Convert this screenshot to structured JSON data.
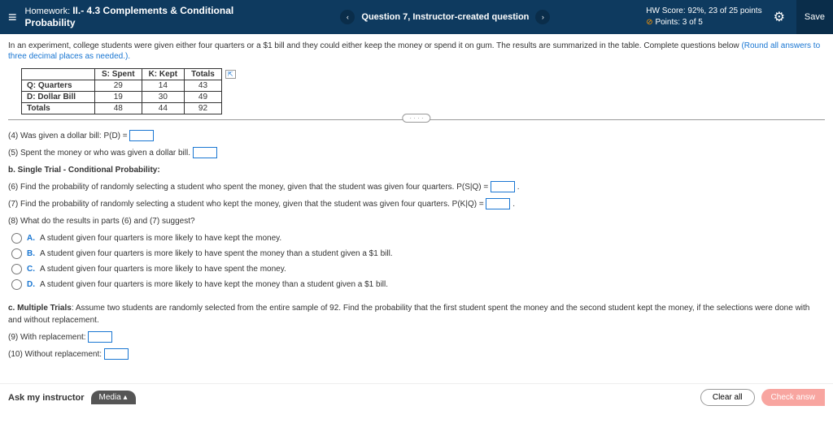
{
  "header": {
    "hw_label": "Homework:",
    "hw_title": "II.- 4.3 Complements & Conditional Probability",
    "question": "Question 7, Instructor-created question",
    "score_line": "HW Score: 92%, 23 of 25 points",
    "points_line": "Points: 3 of 5",
    "save": "Save"
  },
  "intro": {
    "text": "In an experiment, college students were given either four quarters or a $1 bill and they could either keep the money or spend it on gum. The results are summarized in the table. Complete questions below ",
    "note": "(Round all answers to three decimal places as needed.)."
  },
  "table": {
    "h1": "S: Spent",
    "h2": "K: Kept",
    "h3": "Totals",
    "r1": {
      "label": "Q: Quarters",
      "c1": "29",
      "c2": "14",
      "c3": "43"
    },
    "r2": {
      "label": "D: Dollar Bill",
      "c1": "19",
      "c2": "30",
      "c3": "49"
    },
    "r3": {
      "label": "Totals",
      "c1": "48",
      "c2": "44",
      "c3": "92"
    }
  },
  "q4": "(4) Was given a dollar bill: P(D) = ",
  "q5": "(5) Spent the money or who was given a dollar bill. ",
  "bheader": "b. Single Trial - Conditional Probability:",
  "q6": "(6) Find the probability of randomly selecting a student who spent the money, given that the student was given four quarters. P(S|Q) = ",
  "q7": "(7) Find the probability of randomly selecting a student who kept the money, given that the student was given four quarters. P(K|Q) = ",
  "q8": "(8) What do the results in parts (6) and (7) suggest?",
  "opts": {
    "a": "A student given four quarters is more likely to have kept the money.",
    "b": "A student given four quarters is more likely to have spent the money than a student given a $1 bill.",
    "c": "A student given four quarters is more likely to have spent the money.",
    "d": "A student given four quarters is more likely to have kept the money than a student given a $1 bill."
  },
  "cheader": "c. Multiple Trials",
  "ctext": ": Assume two students are randomly selected from the entire sample of 92. Find the probability that the first student spent the money and the second student kept the money, if the selections were done with and without replacement.",
  "q9": "(9) With replacement: ",
  "q10": "(10) Without replacement: ",
  "footer": {
    "ask": "Ask my instructor",
    "media": "Media ▴",
    "clear": "Clear all",
    "check": "Check answ"
  },
  "labels": {
    "A": "A.",
    "B": "B.",
    "C": "C.",
    "D": "D."
  },
  "dots": "· · · ·"
}
